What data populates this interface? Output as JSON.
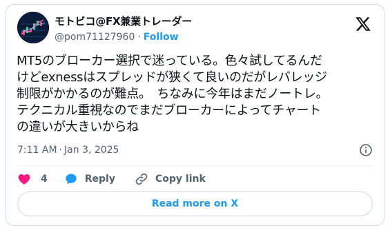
{
  "author": {
    "display_name": "モトビコ@FX兼業トレーダー",
    "handle": "@pom71127960",
    "separator": "·",
    "follow_label": "Follow"
  },
  "tweet": {
    "lines": [
      "MT5のブローカー選択で迷っている。色々試してるんだ",
      "けどexnessはスプレッドが狭くて良いのだがレバレッジ",
      "制限がかかるのが難点。　ちなみに今年はまだノートレ。",
      "テクニカル重視なのでまだブローカーによってチャート",
      "の違いが大きいからね"
    ],
    "time": "7:11 AM",
    "date": "Jan 3, 2025"
  },
  "actions": {
    "like_count": "4",
    "reply_label": "Reply",
    "copy_label": "Copy link"
  },
  "read_more_label": "Read more on X",
  "colors": {
    "accent": "#1d9bf0",
    "like": "#f91880",
    "secondary_text": "#536471",
    "border": "#cfd9de"
  },
  "icons": {
    "logo": "x-logo-icon",
    "info": "info-icon",
    "like": "heart-icon",
    "reply": "speech-bubble-icon",
    "copy": "link-icon"
  }
}
